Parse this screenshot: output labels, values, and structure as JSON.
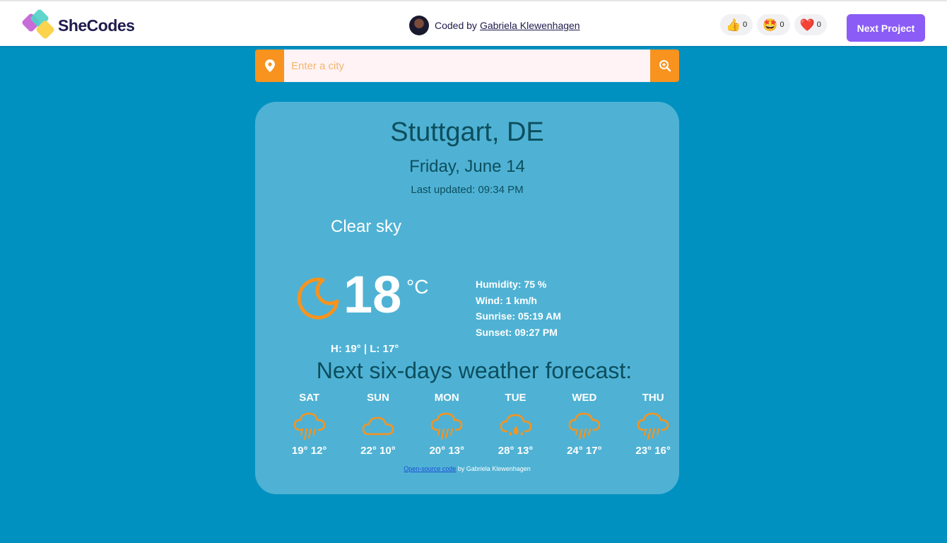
{
  "header": {
    "logo_text": "SheCodes",
    "coded_by_prefix": "Coded by",
    "author": "Gabriela Klewenhagen",
    "reactions": [
      {
        "icon": "thumbs-up-icon",
        "emoji": "👍",
        "count": "0"
      },
      {
        "icon": "star-struck-icon",
        "emoji": "🤩",
        "count": "0"
      },
      {
        "icon": "heart-icon",
        "emoji": "❤️",
        "count": "0"
      }
    ],
    "next_button": "Next Project"
  },
  "search": {
    "placeholder": "Enter a city",
    "value": ""
  },
  "weather": {
    "city": "Stuttgart, DE",
    "date": "Friday, June 14",
    "last_updated": "Last updated: 09:34 PM",
    "description": "Clear sky",
    "temperature": "18",
    "unit": "°C",
    "high_low": "H: 19° | L: 17°",
    "humidity": "Humidity: 75 %",
    "wind": "Wind: 1 km/h",
    "sunrise": "Sunrise: 05:19 AM",
    "sunset": "Sunset: 09:27 PM",
    "main_icon": "moon-icon"
  },
  "forecast": {
    "title": "Next six-days weather forecast:",
    "days": [
      {
        "day": "SAT",
        "icon": "rain-cloud-icon",
        "temps": "19° 12°"
      },
      {
        "day": "SUN",
        "icon": "cloud-icon",
        "temps": "22° 10°"
      },
      {
        "day": "MON",
        "icon": "rain-cloud-icon",
        "temps": "20° 13°"
      },
      {
        "day": "TUE",
        "icon": "drizzle-cloud-icon",
        "temps": "28° 13°"
      },
      {
        "day": "WED",
        "icon": "rain-cloud-icon",
        "temps": "24° 17°"
      },
      {
        "day": "THU",
        "icon": "rain-cloud-icon",
        "temps": "23° 16°"
      }
    ]
  },
  "footer": {
    "link_text": "Open-source code",
    "suffix": " by Gabriela Klewenhagen"
  },
  "colors": {
    "background": "#0191c1",
    "card": "#4fb2d4",
    "accent": "#f7931e",
    "button": "#8b5cf6",
    "title_text": "#0c4e5e"
  }
}
